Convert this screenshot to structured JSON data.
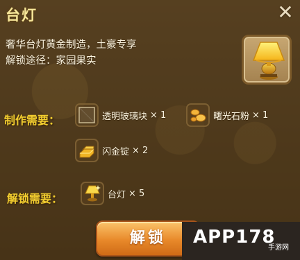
{
  "dialog": {
    "title": "台灯",
    "description_line1": "奢华台灯黄金制造，土豪专享",
    "description_line2": "解锁途径：家园果实",
    "preview_icon": "golden-lamp-icon"
  },
  "craft": {
    "label": "制作需要：",
    "items": [
      {
        "name": "透明玻璃块",
        "qty": "× 1",
        "icon": "glass-block-icon"
      },
      {
        "name": "曙光石粉",
        "qty": "× 1",
        "icon": "dawn-stone-powder-icon"
      },
      {
        "name": "闪金锭",
        "qty": "× 2",
        "icon": "gold-ingot-icon"
      }
    ]
  },
  "unlock": {
    "label": "解锁需要：",
    "item": {
      "name": "台灯",
      "qty": "× 5",
      "icon": "lamp-fragment-icon"
    },
    "button_label": "解锁"
  },
  "watermark": {
    "brand": "APP178",
    "sub": "手游网"
  },
  "colors": {
    "title": "#f7e79a",
    "label": "#f2cd2f",
    "button": "#e8892a"
  }
}
